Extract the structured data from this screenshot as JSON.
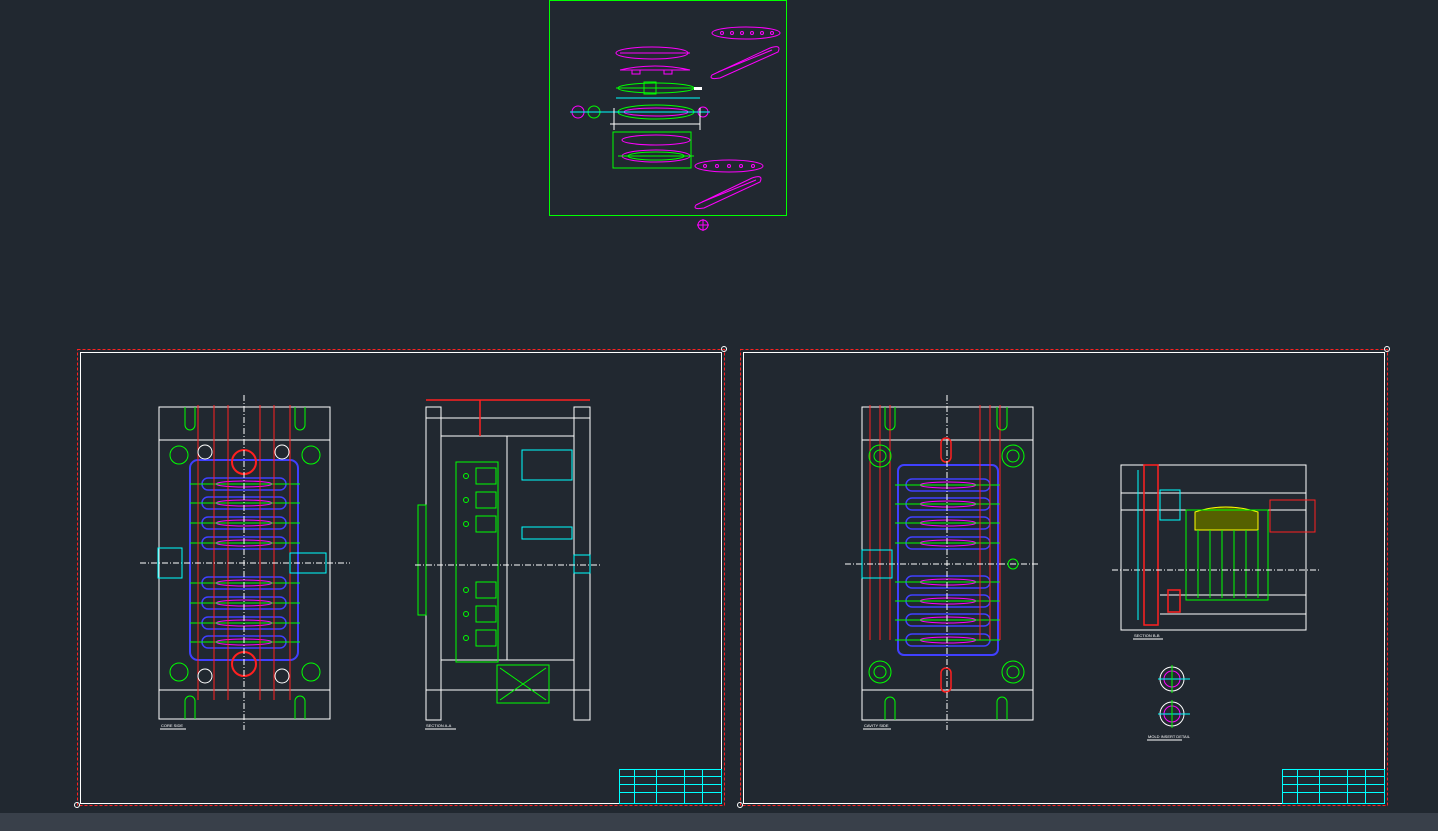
{
  "colors": {
    "background": "#212830",
    "red": "#ff2020",
    "white": "#ffffff",
    "green": "#00ff00",
    "cyan": "#00ffff",
    "magenta": "#ff00ff",
    "blue": "#4040ff",
    "yellow": "#ffff00",
    "status_strip": "#39404a"
  },
  "sheets": {
    "left": {
      "view1_label": "CORE SIDE",
      "view2_label": "SECTION A-A"
    },
    "right": {
      "view1_label": "CAVITY SIDE",
      "view2_label": "SECTION B-B",
      "detail_label": "MOLD INSERT DETAIL"
    }
  },
  "icons": {
    "ucs": "ucs-origin-icon",
    "grip": "grip-handle-icon"
  }
}
